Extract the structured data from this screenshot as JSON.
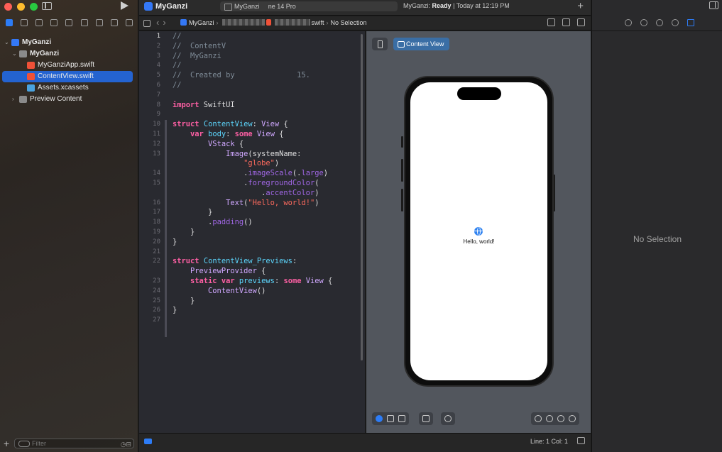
{
  "colors": {
    "accent": "#2d7cf6",
    "selection": "#2463d0",
    "close": "#fe5f57",
    "minimize": "#febc2e",
    "zoom": "#28c840"
  },
  "toolbar": {
    "app_name": "MyGanzi",
    "scheme": "MyGanzi      ne 14 Pro",
    "status_app": "MyGanzi:",
    "status_state": "Ready",
    "status_time": "| Today at 12:19 PM"
  },
  "jumpbar": {
    "project": "MyGanzi",
    "file_suffix": "swift",
    "selection": "No Selection"
  },
  "navigator": {
    "items": [
      {
        "label": "MyGanzi",
        "icon": "project-icon",
        "level": 0,
        "expanded": true
      },
      {
        "label": "MyGanzi",
        "icon": "folder-icon",
        "level": 1,
        "expanded": true
      },
      {
        "label": "MyGanziApp.swift",
        "icon": "swift-file-icon",
        "level": 2
      },
      {
        "label": "ContentView.swift",
        "icon": "swift-file-icon",
        "level": 2,
        "selected": true
      },
      {
        "label": "Assets.xcassets",
        "icon": "asset-catalog-icon",
        "level": 2
      },
      {
        "label": "Preview Content",
        "icon": "folder-icon",
        "level": 1,
        "expanded": false
      }
    ],
    "filter_placeholder": "Filter"
  },
  "editor": {
    "current_line": 1,
    "lines": [
      {
        "n": "1",
        "t": [
          [
            "cm",
            "//"
          ]
        ]
      },
      {
        "n": "2",
        "t": [
          [
            "cm",
            "//  ContentV      "
          ]
        ]
      },
      {
        "n": "3",
        "t": [
          [
            "cm",
            "//  MyGanzi"
          ]
        ]
      },
      {
        "n": "4",
        "t": [
          [
            "cm",
            "//"
          ]
        ]
      },
      {
        "n": "5",
        "t": [
          [
            "cm",
            "//  Created by              15."
          ]
        ]
      },
      {
        "n": "6",
        "t": [
          [
            "cm",
            "//"
          ]
        ]
      },
      {
        "n": "7",
        "t": []
      },
      {
        "n": "8",
        "t": [
          [
            "kw",
            "import"
          ],
          [
            "pl",
            " SwiftUI"
          ]
        ]
      },
      {
        "n": "9",
        "t": []
      },
      {
        "n": "10",
        "t": [
          [
            "kw",
            "struct"
          ],
          [
            "pl",
            " "
          ],
          [
            "ty",
            "ContentView"
          ],
          [
            "pl",
            ": "
          ],
          [
            "ex",
            "View"
          ],
          [
            "pl",
            " {"
          ]
        ]
      },
      {
        "n": "11",
        "t": [
          [
            "pl",
            "    "
          ],
          [
            "kw",
            "var"
          ],
          [
            "pl",
            " "
          ],
          [
            "ty",
            "body"
          ],
          [
            "pl",
            ": "
          ],
          [
            "kw",
            "some"
          ],
          [
            "pl",
            " "
          ],
          [
            "ex",
            "View"
          ],
          [
            "pl",
            " {"
          ]
        ]
      },
      {
        "n": "12",
        "t": [
          [
            "pl",
            "        "
          ],
          [
            "ex",
            "VStack"
          ],
          [
            "pl",
            " {"
          ]
        ]
      },
      {
        "n": "13",
        "t": [
          [
            "pl",
            "            "
          ],
          [
            "ex",
            "Image"
          ],
          [
            "pl",
            "(systemName:"
          ]
        ]
      },
      {
        "n": "",
        "t": [
          [
            "pl",
            "                "
          ],
          [
            "st",
            "\"globe\""
          ],
          [
            "pl",
            ")"
          ]
        ]
      },
      {
        "n": "14",
        "t": [
          [
            "pl",
            "                ."
          ],
          [
            "fn",
            "imageScale"
          ],
          [
            "pl",
            "(."
          ],
          [
            "fn",
            "large"
          ],
          [
            "pl",
            ")"
          ]
        ]
      },
      {
        "n": "15",
        "t": [
          [
            "pl",
            "                ."
          ],
          [
            "fn",
            "foregroundColor"
          ],
          [
            "pl",
            "("
          ]
        ]
      },
      {
        "n": "",
        "t": [
          [
            "pl",
            "                    ."
          ],
          [
            "fn",
            "accentColor"
          ],
          [
            "pl",
            ")"
          ]
        ]
      },
      {
        "n": "16",
        "t": [
          [
            "pl",
            "            "
          ],
          [
            "ex",
            "Text"
          ],
          [
            "pl",
            "("
          ],
          [
            "st",
            "\"Hello, world!\""
          ],
          [
            "pl",
            ")"
          ]
        ]
      },
      {
        "n": "17",
        "t": [
          [
            "pl",
            "        }"
          ]
        ]
      },
      {
        "n": "18",
        "t": [
          [
            "pl",
            "        ."
          ],
          [
            "fn",
            "padding"
          ],
          [
            "pl",
            "()"
          ]
        ]
      },
      {
        "n": "19",
        "t": [
          [
            "pl",
            "    }"
          ]
        ]
      },
      {
        "n": "20",
        "t": [
          [
            "pl",
            "}"
          ]
        ]
      },
      {
        "n": "21",
        "t": []
      },
      {
        "n": "22",
        "t": [
          [
            "kw",
            "struct"
          ],
          [
            "pl",
            " "
          ],
          [
            "ty",
            "ContentView_Previews"
          ],
          [
            "pl",
            ":"
          ]
        ]
      },
      {
        "n": "",
        "t": [
          [
            "pl",
            "    "
          ],
          [
            "ex",
            "PreviewProvider"
          ],
          [
            "pl",
            " {"
          ]
        ]
      },
      {
        "n": "23",
        "t": [
          [
            "pl",
            "    "
          ],
          [
            "kw",
            "static"
          ],
          [
            "pl",
            " "
          ],
          [
            "kw",
            "var"
          ],
          [
            "pl",
            " "
          ],
          [
            "ty",
            "previews"
          ],
          [
            "pl",
            ": "
          ],
          [
            "kw",
            "some"
          ],
          [
            "pl",
            " "
          ],
          [
            "ex",
            "View"
          ],
          [
            "pl",
            " {"
          ]
        ]
      },
      {
        "n": "24",
        "t": [
          [
            "pl",
            "        "
          ],
          [
            "ex",
            "ContentView"
          ],
          [
            "pl",
            "()"
          ]
        ]
      },
      {
        "n": "25",
        "t": [
          [
            "pl",
            "    }"
          ]
        ]
      },
      {
        "n": "26",
        "t": [
          [
            "pl",
            "}"
          ]
        ]
      },
      {
        "n": "27",
        "t": []
      }
    ]
  },
  "canvas": {
    "tab_label": "Content View",
    "preview_text": "Hello, world!"
  },
  "inspector": {
    "empty_label": "No Selection"
  },
  "status": {
    "cursor": "Line: 1  Col: 1"
  }
}
